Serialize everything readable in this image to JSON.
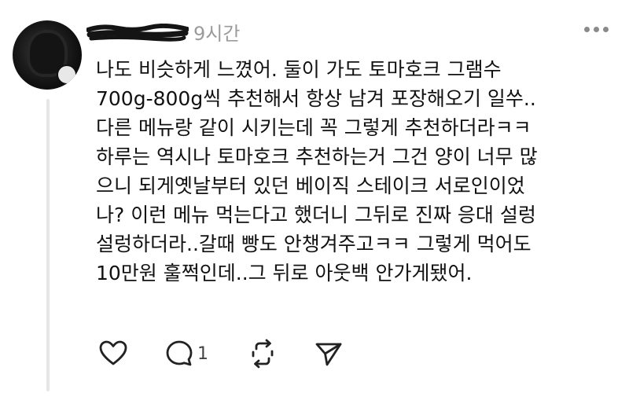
{
  "post": {
    "username": "",
    "time": "9시간",
    "text_lines": [
      "나도 비슷하게 느꼈어. 둘이 가도 토마호크 그램수",
      "700g-800g씩 추천해서 항상 남겨 포장해오기 일쑤..",
      "다른 메뉴랑 같이 시키는데 꼭 그렇게 추천하더라ㅋㅋ",
      "하루는 역시나 토마호크 추천하는거 그건 양이 너무 많",
      "으니 되게옛날부터 있던 베이직 스테이크 서로인이었",
      "나? 이런 메뉴 먹는다고 했더니 그뒤로 진짜 응대 설렁",
      "설렁하더라..갈때 빵도 안챙겨주고ㅋㅋ 그렇게 먹어도",
      "10만원 훌쩍인데..그 뒤로 아웃백 안가게됐어."
    ],
    "reply_count": "1"
  },
  "icons": {
    "more": "more-horizontal-icon",
    "like": "heart-icon",
    "reply": "comment-bubble-icon",
    "repost": "repost-icon",
    "share": "send-icon"
  },
  "colors": {
    "text": "#111111",
    "muted": "#9b9b9b",
    "thread_line": "#e6e6e6"
  }
}
